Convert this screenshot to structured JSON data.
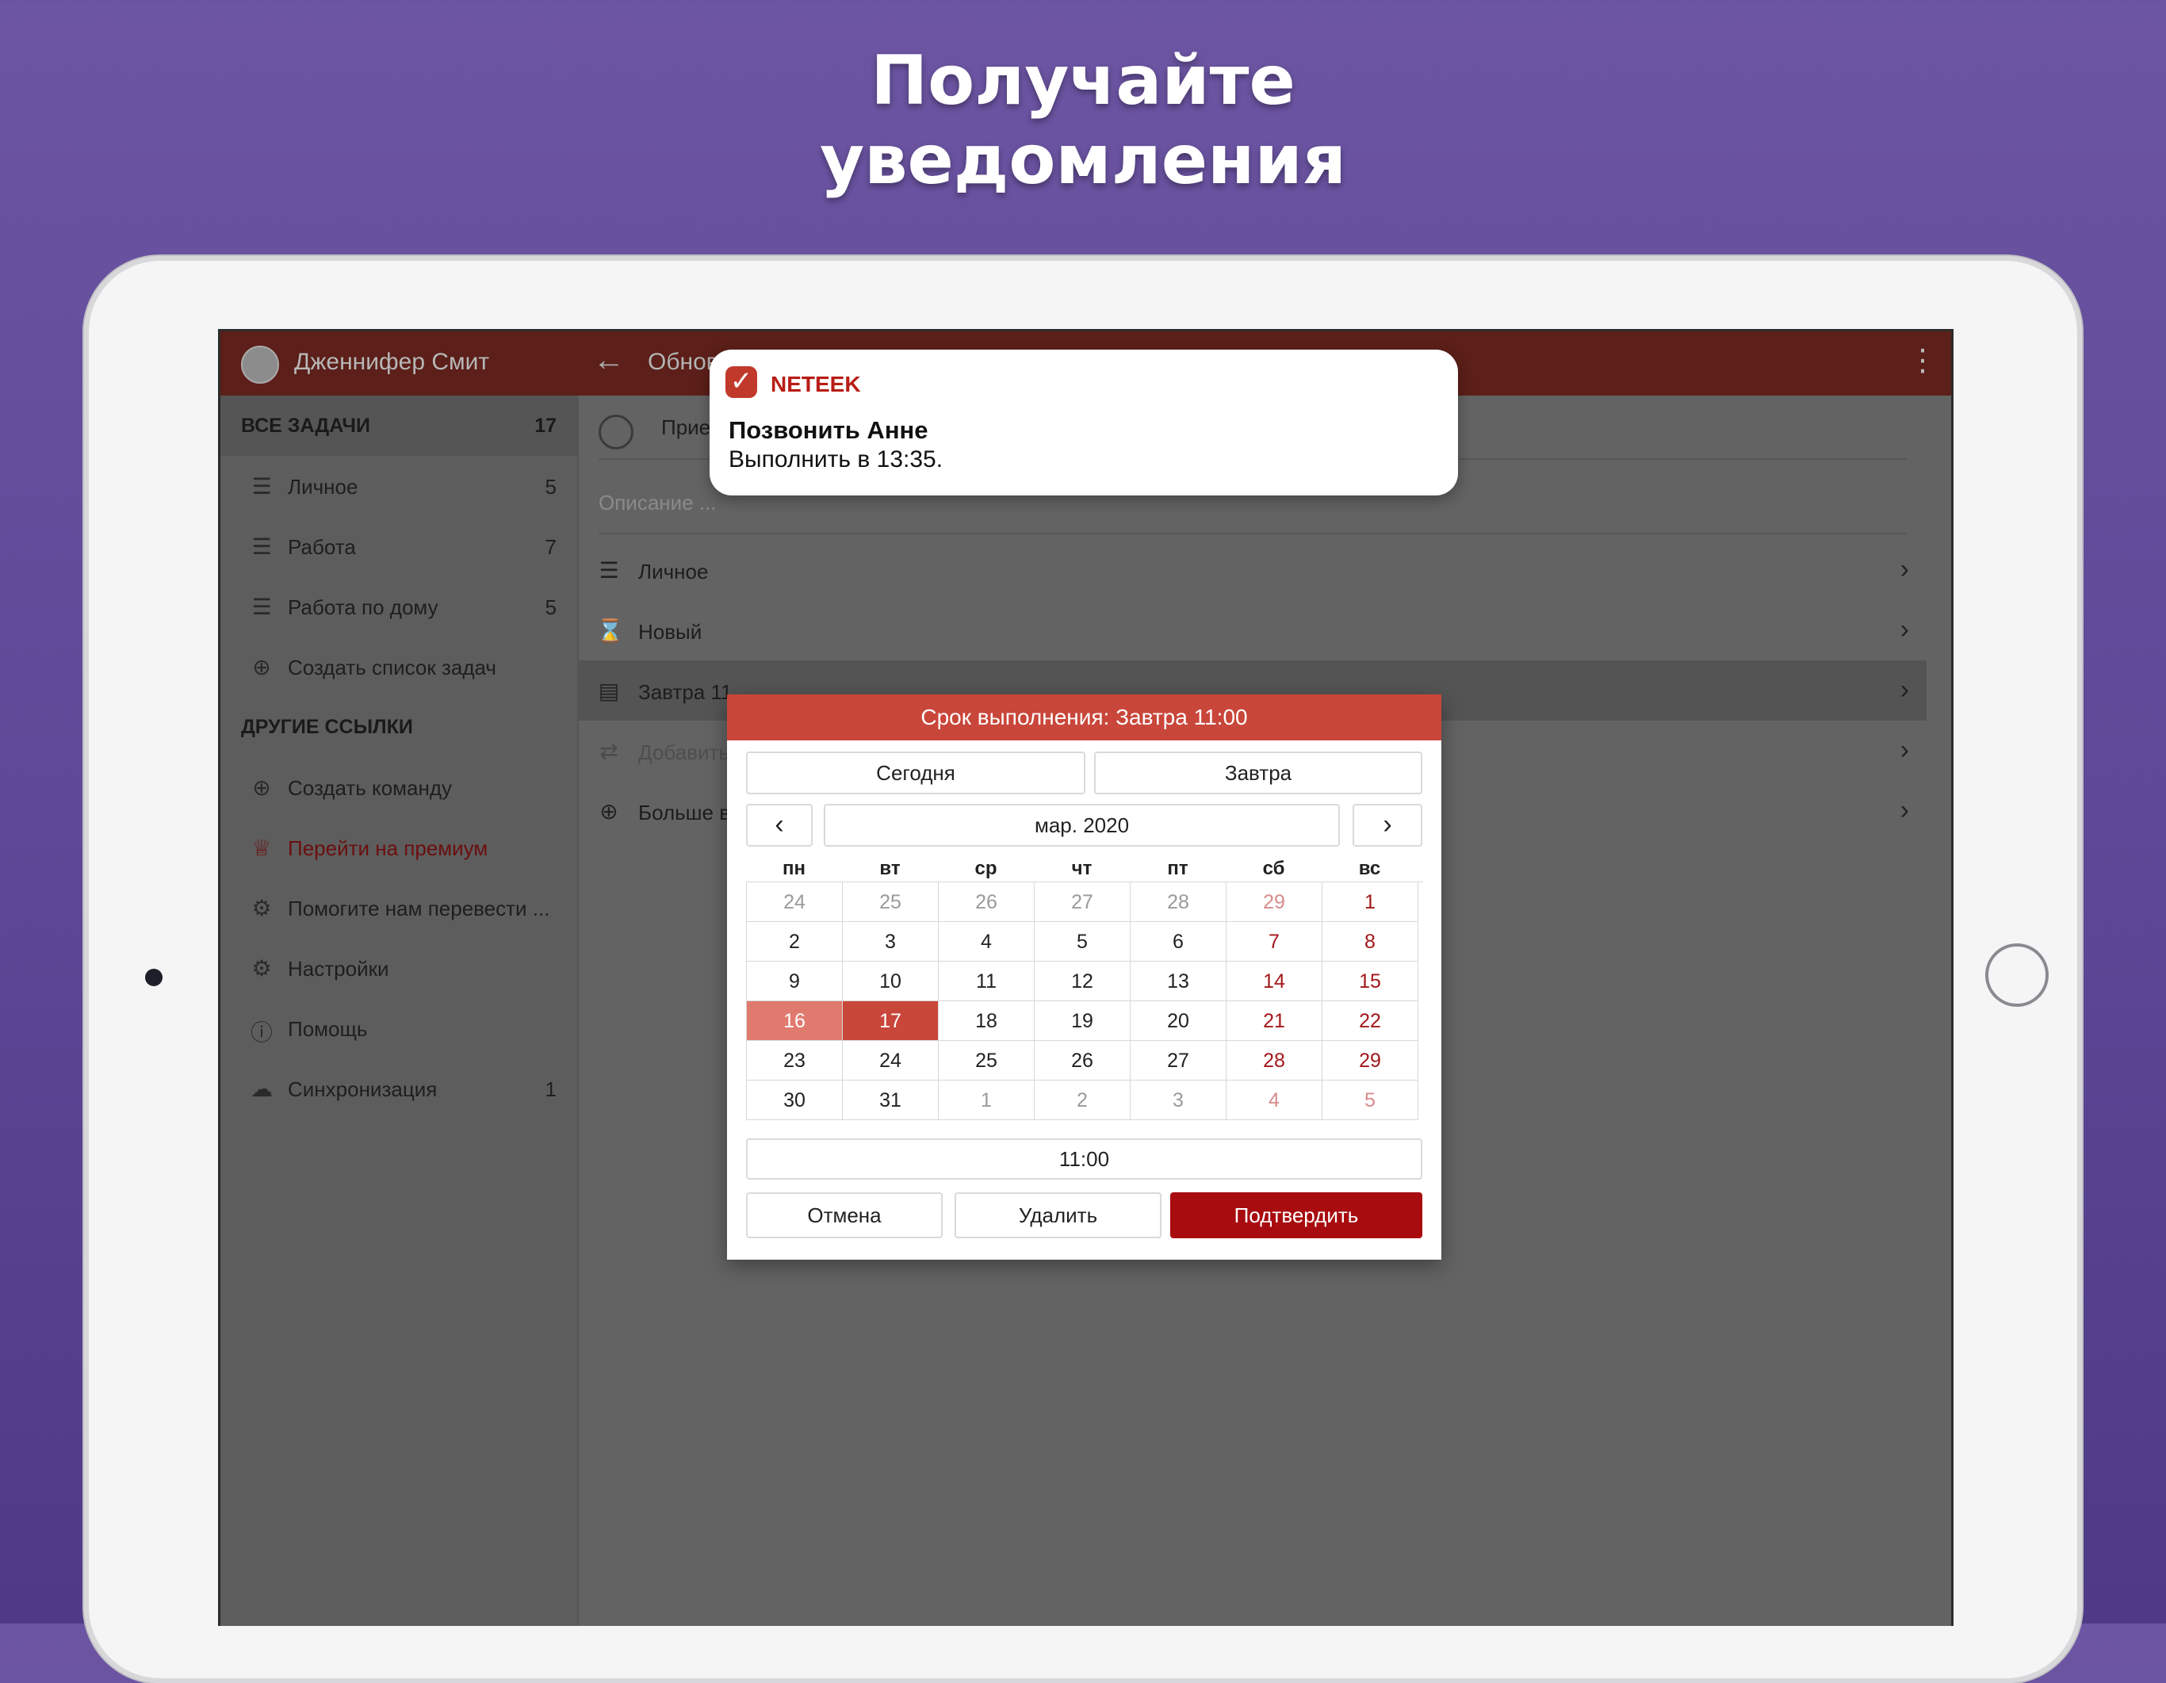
{
  "headline": {
    "line1": "Получайте",
    "line2": "уведомления"
  },
  "app": {
    "user_name": "Дженнифер Смит",
    "title": "Обнов",
    "back_icon": "arrow-left-icon",
    "menu_icon": "more-vertical-icon"
  },
  "sidebar": {
    "all_tasks_label": "ВСЕ ЗАДАЧИ",
    "all_tasks_count": "17",
    "lists": [
      {
        "label": "Личное",
        "count": "5",
        "icon": "list-icon"
      },
      {
        "label": "Работа",
        "count": "7",
        "icon": "list-icon"
      },
      {
        "label": "Работа по дому",
        "count": "5",
        "icon": "list-icon"
      }
    ],
    "create_list": "Создать список задач",
    "other_links_label": "ДРУГИЕ ССЫЛКИ",
    "links": [
      {
        "label": "Создать команду",
        "icon": "plus-circle-icon"
      },
      {
        "label": "Перейти на премиум",
        "icon": "crown-icon"
      },
      {
        "label": "Помогите нам перевести ...",
        "icon": "lifebuoy-icon"
      },
      {
        "label": "Настройки",
        "icon": "gear-icon"
      },
      {
        "label": "Помощь",
        "icon": "help-circle-icon"
      },
      {
        "label": "Синхронизация",
        "icon": "cloud-upload-icon",
        "count": "1"
      }
    ]
  },
  "task": {
    "title_partial": "Прие",
    "description_placeholder": "Описание ...",
    "list_value": "Личное",
    "status_value": "Новый",
    "due_value": "Завтра 11",
    "repeat_value": "Добавить",
    "more_value": "Больше в"
  },
  "notification": {
    "app_name": "NETEEK",
    "title": "Позвонить Анне",
    "body": "Выполнить в 13:35."
  },
  "dialog": {
    "header": "Срок выполнения: Завтра 11:00",
    "today_btn": "Сегодня",
    "tomorrow_btn": "Завтра",
    "month": "мар. 2020",
    "weekdays": [
      "пн",
      "вт",
      "ср",
      "чт",
      "пт",
      "сб",
      "вс"
    ],
    "weeks": [
      [
        "24",
        "25",
        "26",
        "27",
        "28",
        "29",
        "1"
      ],
      [
        "2",
        "3",
        "4",
        "5",
        "6",
        "7",
        "8"
      ],
      [
        "9",
        "10",
        "11",
        "12",
        "13",
        "14",
        "15"
      ],
      [
        "16",
        "17",
        "18",
        "19",
        "20",
        "21",
        "22"
      ],
      [
        "23",
        "24",
        "25",
        "26",
        "27",
        "28",
        "29"
      ],
      [
        "30",
        "31",
        "1",
        "2",
        "3",
        "4",
        "5"
      ]
    ],
    "today_day": "16",
    "selected_day": "17",
    "time": "11:00",
    "cancel_btn": "Отмена",
    "delete_btn": "Удалить",
    "confirm_btn": "Подтвердить"
  },
  "colors": {
    "accent": "#c9463a",
    "confirm": "#a80c0f",
    "background": "#5d4796"
  }
}
